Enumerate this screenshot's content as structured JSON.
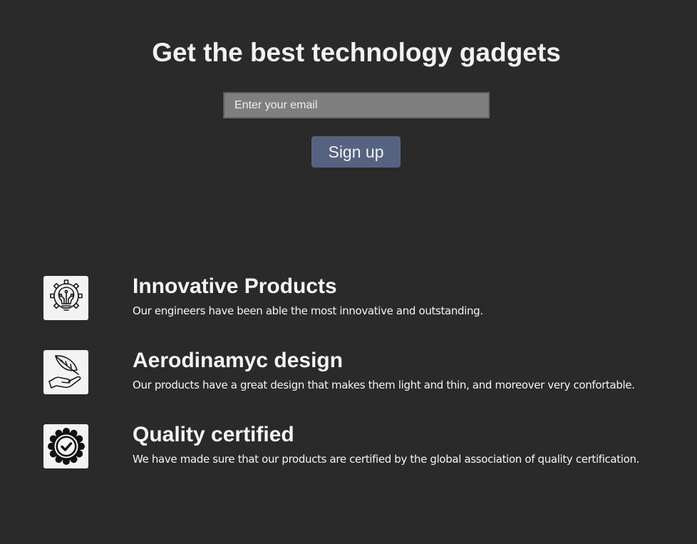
{
  "hero": {
    "title": "Get the best technology gadgets",
    "email_placeholder": "Enter your email",
    "signup_label": "Sign up"
  },
  "features": [
    {
      "icon": "lightbulb-gear-icon",
      "title": "Innovative Products",
      "description": "Our engineers have been able the most innovative and outstanding."
    },
    {
      "icon": "feather-hand-icon",
      "title": "Aerodinamyc design",
      "description": "Our products have a great design that makes them light and thin, and moreover very confortable."
    },
    {
      "icon": "quality-badge-icon",
      "title": "Quality certified",
      "description": "We have made sure that our products are certified by the global association of quality certification."
    }
  ],
  "colors": {
    "background": "#2a2a2a",
    "button": "#566380",
    "input": "#7f7f7f",
    "icon_tile": "#f3f3f3"
  }
}
